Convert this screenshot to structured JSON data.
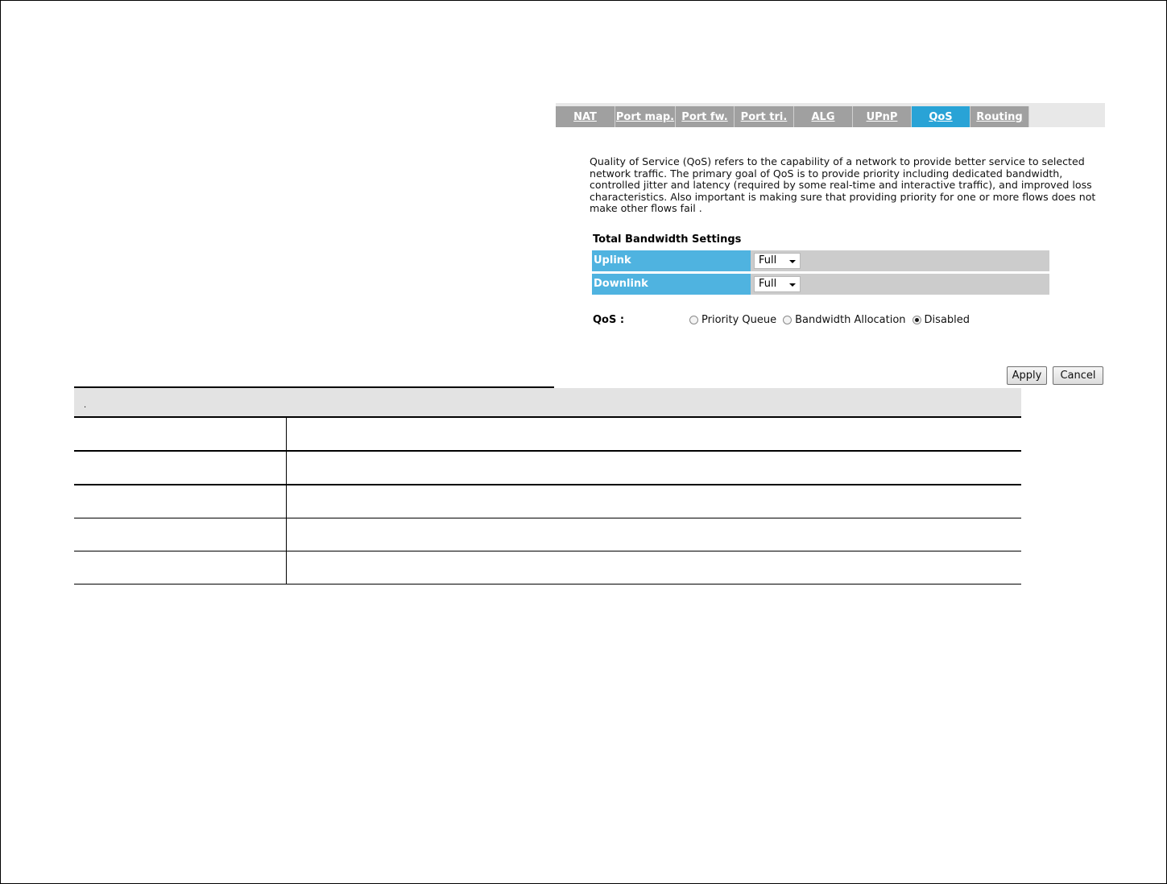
{
  "tabs": [
    {
      "label": "NAT",
      "active": false
    },
    {
      "label": "Port map.",
      "active": false
    },
    {
      "label": "Port fw.",
      "active": false
    },
    {
      "label": "Port tri.",
      "active": false
    },
    {
      "label": "ALG",
      "active": false
    },
    {
      "label": "UPnP",
      "active": false
    },
    {
      "label": "QoS",
      "active": true
    },
    {
      "label": "Routing",
      "active": false
    }
  ],
  "description": "Quality of Service (QoS) refers to the capability of a network to provide better service to selected network traffic. The primary goal of QoS is to provide priority including dedicated bandwidth, controlled jitter and latency (required by some real-time and interactive traffic), and improved loss characteristics. Also important is making sure that providing priority for one or more flows does not make other flows fail .",
  "bandwidth": {
    "title": "Total Bandwidth Settings",
    "uplink_label": "Uplink",
    "uplink_value": "Full",
    "downlink_label": "Downlink",
    "downlink_value": "Full"
  },
  "qos": {
    "label": "QoS :",
    "options": [
      {
        "label": "Priority Queue",
        "checked": false
      },
      {
        "label": "Bandwidth Allocation",
        "checked": false
      },
      {
        "label": "Disabled",
        "checked": true
      }
    ]
  },
  "buttons": {
    "apply": "Apply",
    "cancel": "Cancel"
  },
  "table": {
    "header_text": "."
  },
  "colors": {
    "tab_bg": "#a0a0a0",
    "tab_active": "#29a3d6",
    "label_bg": "#4fb3e0",
    "row_bg": "#cccccc"
  }
}
